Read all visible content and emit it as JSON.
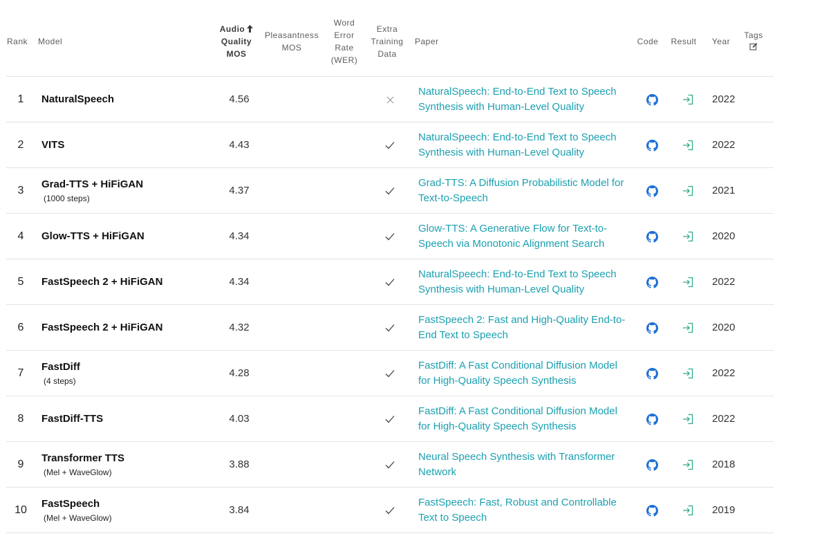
{
  "header": {
    "rank": "Rank",
    "model": "Model",
    "audio_quality": [
      "Audio",
      "Quality",
      "MOS"
    ],
    "pleasantness": [
      "Pleasantness",
      "MOS"
    ],
    "wer": [
      "Word",
      "Error",
      "Rate",
      "(WER)"
    ],
    "extra_training": [
      "Extra",
      "Training",
      "Data"
    ],
    "paper": "Paper",
    "code": "Code",
    "result": "Result",
    "year": "Year",
    "tags": "Tags"
  },
  "icons": {
    "sort": "arrow-up-icon",
    "tags_edit": "edit-icon",
    "code": "github-icon",
    "result": "sign-in-icon",
    "extra_yes": "checkmark-icon",
    "extra_no": "cross-icon"
  },
  "colors": {
    "link": "#1ba0b0",
    "github": "#1f6fd6",
    "result_icon": "#2eac8a"
  },
  "rows": [
    {
      "rank": "1",
      "model": "NaturalSpeech",
      "sub": "",
      "mos": "4.56",
      "extra": "no",
      "paper": [
        "NaturalSpeech: End-to-End Text to Speech",
        "Synthesis with Human-Level Quality"
      ],
      "year": "2022"
    },
    {
      "rank": "2",
      "model": "VITS",
      "sub": "",
      "mos": "4.43",
      "extra": "yes",
      "paper": [
        "NaturalSpeech: End-to-End Text to Speech",
        "Synthesis with Human-Level Quality"
      ],
      "year": "2022"
    },
    {
      "rank": "3",
      "model": "Grad-TTS + HiFiGAN",
      "sub": "(1000 steps)",
      "mos": "4.37",
      "extra": "yes",
      "paper": [
        "Grad-TTS: A Diffusion Probabilistic Model for",
        "Text-to-Speech"
      ],
      "year": "2021"
    },
    {
      "rank": "4",
      "model": "Glow-TTS + HiFiGAN",
      "sub": "",
      "mos": "4.34",
      "extra": "yes",
      "paper": [
        "Glow-TTS: A Generative Flow for Text-to-",
        "Speech via Monotonic Alignment Search"
      ],
      "year": "2020"
    },
    {
      "rank": "5",
      "model": "FastSpeech 2 + HiFiGAN",
      "sub": "",
      "mos": "4.34",
      "extra": "yes",
      "paper": [
        "NaturalSpeech: End-to-End Text to Speech",
        "Synthesis with Human-Level Quality"
      ],
      "year": "2022"
    },
    {
      "rank": "6",
      "model": "FastSpeech 2 + HiFiGAN",
      "sub": "",
      "mos": "4.32",
      "extra": "yes",
      "paper": [
        "FastSpeech 2: Fast and High-Quality End-to-",
        "End Text to Speech"
      ],
      "year": "2020"
    },
    {
      "rank": "7",
      "model": "FastDiff",
      "sub": "(4 steps)",
      "mos": "4.28",
      "extra": "yes",
      "paper": [
        "FastDiff: A Fast Conditional Diffusion Model",
        "for High-Quality Speech Synthesis"
      ],
      "year": "2022"
    },
    {
      "rank": "8",
      "model": "FastDiff-TTS",
      "sub": "",
      "mos": "4.03",
      "extra": "yes",
      "paper": [
        "FastDiff: A Fast Conditional Diffusion Model",
        "for High-Quality Speech Synthesis"
      ],
      "year": "2022"
    },
    {
      "rank": "9",
      "model": "Transformer TTS",
      "sub": "(Mel + WaveGlow)",
      "mos": "3.88",
      "extra": "yes",
      "paper": [
        "Neural Speech Synthesis with Transformer",
        "Network"
      ],
      "year": "2018"
    },
    {
      "rank": "10",
      "model": "FastSpeech",
      "sub": "(Mel + WaveGlow)",
      "mos": "3.84",
      "extra": "yes",
      "paper": [
        "FastSpeech: Fast, Robust and Controllable",
        "Text to Speech"
      ],
      "year": "2019"
    }
  ]
}
